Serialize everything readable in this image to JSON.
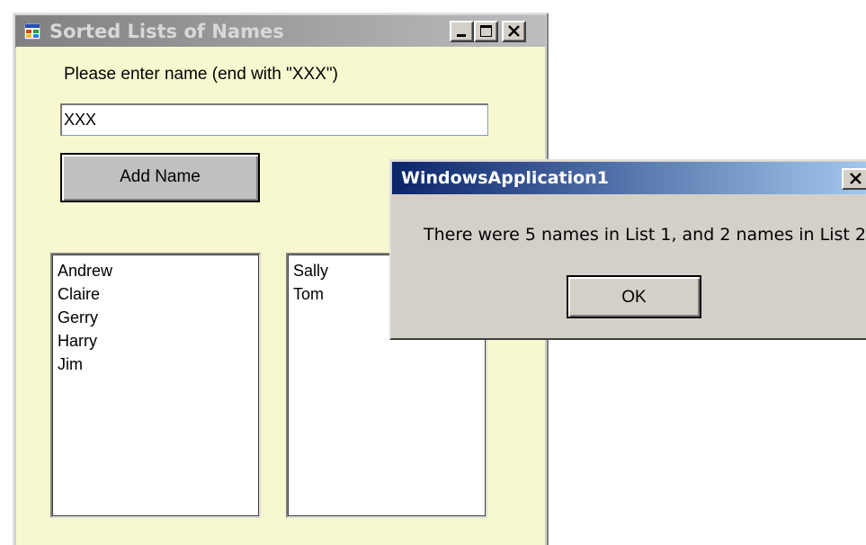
{
  "main_window": {
    "title": "Sorted Lists of Names",
    "icon": "windows-form-icon",
    "caption_buttons": [
      "minimize-icon",
      "maximize-icon",
      "close-icon"
    ],
    "prompt_label": "Please enter name (end with \"XXX\")",
    "name_input": {
      "value": "XXX"
    },
    "add_button_label": "Add Name",
    "list1": {
      "items": [
        "Andrew",
        "Claire",
        "Gerry",
        "Harry",
        "Jim"
      ]
    },
    "list2": {
      "items": [
        "Sally",
        "Tom"
      ]
    },
    "client_background": "#f8f8d0"
  },
  "message_box": {
    "title": "WindowsApplication1",
    "close_icon": "close-icon",
    "message": "There were 5 names in List 1, and 2 names in List 2",
    "ok_label": "OK",
    "titlebar_color": "#0a246a"
  }
}
